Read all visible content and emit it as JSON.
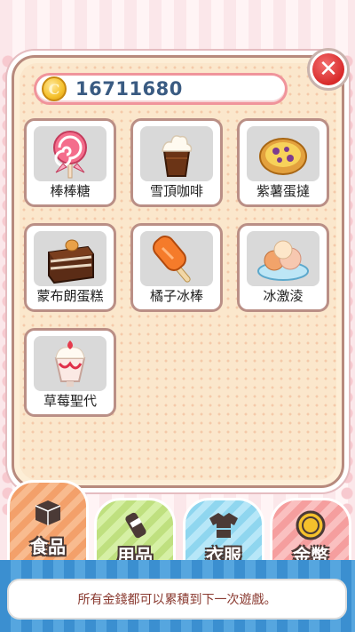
{
  "wallet": {
    "coins": "16711680",
    "coin_glyph": "C"
  },
  "close": {
    "glyph": "✕"
  },
  "items": [
    {
      "label": "棒棒糖",
      "icon": "lollipop-icon"
    },
    {
      "label": "雪頂咖啡",
      "icon": "coffee-float-icon"
    },
    {
      "label": "紫薯蛋撻",
      "icon": "egg-tart-icon"
    },
    {
      "label": "蒙布朗蛋糕",
      "icon": "mont-blanc-cake-icon"
    },
    {
      "label": "橘子冰棒",
      "icon": "orange-popsicle-icon"
    },
    {
      "label": "冰激淩",
      "icon": "ice-cream-icon"
    },
    {
      "label": "草莓聖代",
      "icon": "strawberry-sundae-icon"
    }
  ],
  "tabs": [
    {
      "label": "食品",
      "icon": "food-box-icon",
      "active": true,
      "color": "#f3a06a"
    },
    {
      "label": "用品",
      "icon": "supplies-icon",
      "active": false,
      "color": "#bfe07f"
    },
    {
      "label": "衣服",
      "icon": "shirt-icon",
      "active": false,
      "color": "#8fd6ef"
    },
    {
      "label": "金幣",
      "icon": "coin-icon",
      "active": false,
      "color": "#f59e9e"
    }
  ],
  "footer": {
    "message": "所有金錢都可以累積到下一次遊戲。"
  },
  "colors": {
    "panel": "#fbe7cc",
    "border": "#b78a7d",
    "coin_text": "#3a5b82",
    "close": "#d82a2a"
  }
}
